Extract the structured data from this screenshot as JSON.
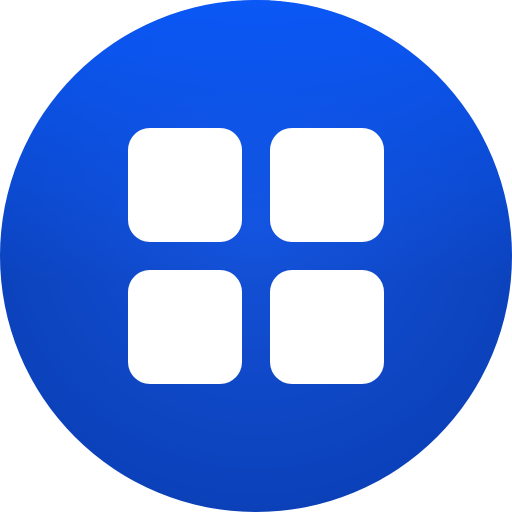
{
  "icon": {
    "name": "apps-grid-icon",
    "colors": {
      "circle_top": "#0A5BFF",
      "circle_mid": "#1553DB",
      "circle_bottom": "#0A3FB6",
      "tile": "#FFFFFF"
    },
    "tiles": [
      "tile-top-left",
      "tile-top-right",
      "tile-bottom-left",
      "tile-bottom-right"
    ]
  }
}
